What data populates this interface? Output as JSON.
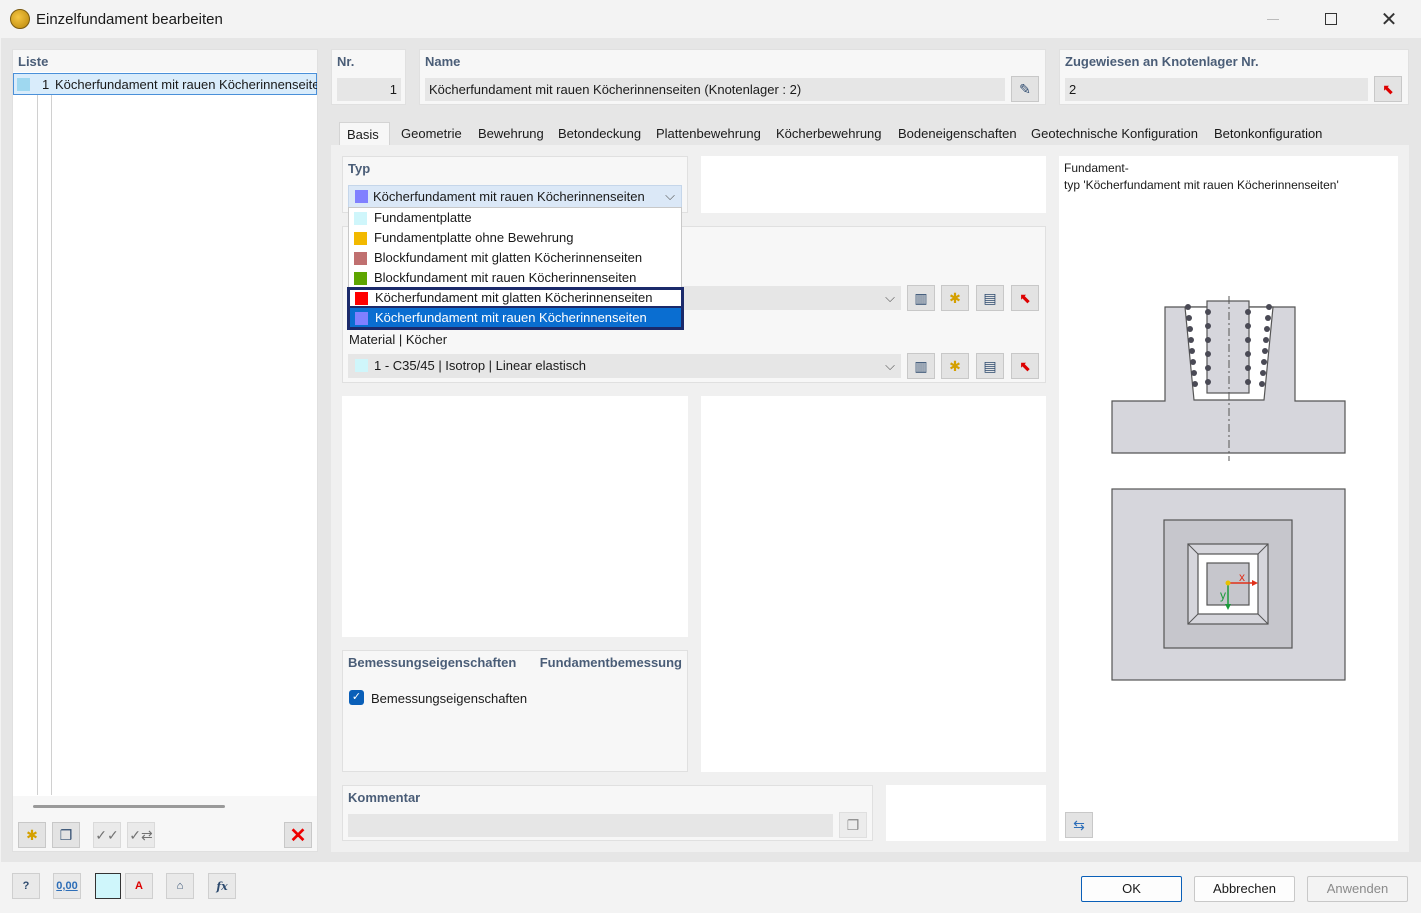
{
  "window": {
    "title": "Einzelfundament bearbeiten"
  },
  "list": {
    "header": "Liste",
    "items": [
      {
        "number": "1",
        "label": "Köcherfundament mit rauen Köcherinnenseite",
        "color": "#9fd8f0"
      }
    ]
  },
  "nr": {
    "header": "Nr.",
    "value": "1"
  },
  "name": {
    "header": "Name",
    "value": "Köcherfundament mit rauen Köcherinnenseiten (Knotenlager : 2)"
  },
  "assigned": {
    "header": "Zugewiesen an Knotenlager Nr.",
    "value": "2"
  },
  "tabs": [
    "Basis",
    "Geometrie",
    "Bewehrung",
    "Betondeckung",
    "Plattenbewehrung",
    "Köcherbewehrung",
    "Bodeneigenschaften",
    "Geotechnische Konfiguration",
    "Betonkonfiguration"
  ],
  "typ": {
    "header": "Typ",
    "selected": {
      "label": "Köcherfundament mit rauen Köcherinnenseiten",
      "color": "#8080ff"
    },
    "options": [
      {
        "label": "Fundamentplatte",
        "color": "#cff6fb"
      },
      {
        "label": "Fundamentplatte ohne Bewehrung",
        "color": "#f2b900"
      },
      {
        "label": "Blockfundament mit glatten Köcherinnenseiten",
        "color": "#c07070"
      },
      {
        "label": "Blockfundament mit rauen Köcherinnenseiten",
        "color": "#5ea500"
      },
      {
        "label": "Köcherfundament mit glatten Köcherinnenseiten",
        "color": "#ff0000"
      },
      {
        "label": "Köcherfundament mit rauen Köcherinnenseiten",
        "color": "#8080ff"
      }
    ]
  },
  "material_koecher": {
    "label": "Material | Köcher",
    "value": "1 - C35/45 | Isotrop | Linear elastisch",
    "color": "#cff6fb"
  },
  "bemessung": {
    "header": "Bemessungseigenschaften",
    "header_right": "Fundamentbemessung",
    "checkbox_label": "Bemessungseigenschaften",
    "checked": true
  },
  "kommentar": {
    "header": "Kommentar",
    "value": ""
  },
  "preview": {
    "caption_line1": "Fundament-",
    "caption_line2": "typ 'Köcherfundament mit rauen Köcherinnenseiten'",
    "axis_x": "x",
    "axis_y": "y"
  },
  "bottom_icons": [
    "help-icon",
    "units-icon",
    "color-icon",
    "display-icon",
    "view-icon",
    "formula-icon"
  ],
  "units_icon_text": "0,00",
  "buttons": {
    "ok": "OK",
    "cancel": "Abbrechen",
    "apply": "Anwenden"
  }
}
